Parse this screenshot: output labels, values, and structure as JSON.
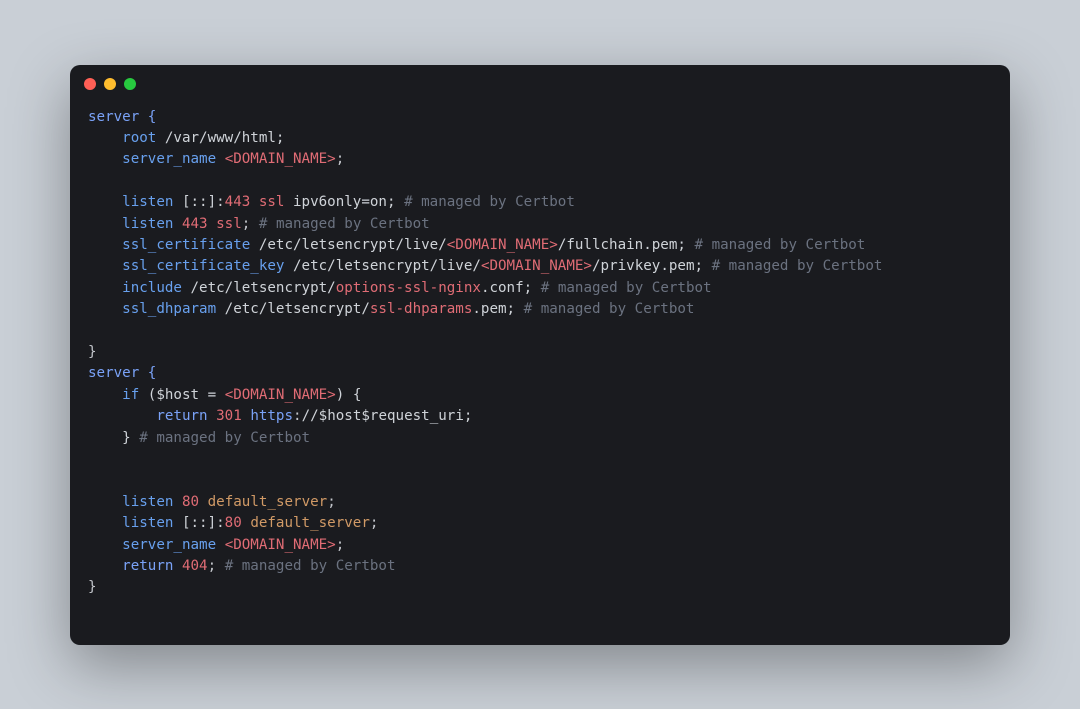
{
  "window": {
    "traffic_lights": [
      "close",
      "minimize",
      "zoom"
    ]
  },
  "code": {
    "lines": [
      [
        {
          "t": "server {",
          "c": "kw"
        }
      ],
      [
        {
          "t": "    ",
          "c": "pun"
        },
        {
          "t": "root",
          "c": "kw2"
        },
        {
          "t": " /var/www/html;",
          "c": "str"
        }
      ],
      [
        {
          "t": "    ",
          "c": "pun"
        },
        {
          "t": "server_name",
          "c": "kw2"
        },
        {
          "t": " ",
          "c": "pun"
        },
        {
          "t": "<DOMAIN_NAME>",
          "c": "var"
        },
        {
          "t": ";",
          "c": "pun"
        }
      ],
      [],
      [
        {
          "t": "    ",
          "c": "pun"
        },
        {
          "t": "listen",
          "c": "kw2"
        },
        {
          "t": " [::]:",
          "c": "str"
        },
        {
          "t": "443",
          "c": "num"
        },
        {
          "t": " ",
          "c": "pun"
        },
        {
          "t": "ssl",
          "c": "num"
        },
        {
          "t": " ipv6only=on; ",
          "c": "str"
        },
        {
          "t": "# managed by Certbot",
          "c": "cmt"
        }
      ],
      [
        {
          "t": "    ",
          "c": "pun"
        },
        {
          "t": "listen",
          "c": "kw2"
        },
        {
          "t": " ",
          "c": "pun"
        },
        {
          "t": "443",
          "c": "num"
        },
        {
          "t": " ",
          "c": "pun"
        },
        {
          "t": "ssl",
          "c": "num"
        },
        {
          "t": "; ",
          "c": "pun"
        },
        {
          "t": "# managed by Certbot",
          "c": "cmt"
        }
      ],
      [
        {
          "t": "    ",
          "c": "pun"
        },
        {
          "t": "ssl_certificate",
          "c": "kw2"
        },
        {
          "t": " /etc/letsencrypt/live/",
          "c": "str"
        },
        {
          "t": "<DOMAIN_NAME>",
          "c": "var"
        },
        {
          "t": "/fullchain.pem; ",
          "c": "str"
        },
        {
          "t": "# managed by Certbot",
          "c": "cmt"
        }
      ],
      [
        {
          "t": "    ",
          "c": "pun"
        },
        {
          "t": "ssl_certificate_key",
          "c": "kw2"
        },
        {
          "t": " /etc/letsencrypt/live/",
          "c": "str"
        },
        {
          "t": "<DOMAIN_NAME>",
          "c": "var"
        },
        {
          "t": "/privkey.pem; ",
          "c": "str"
        },
        {
          "t": "# managed by Certbot",
          "c": "cmt"
        }
      ],
      [
        {
          "t": "    ",
          "c": "pun"
        },
        {
          "t": "include",
          "c": "kw2"
        },
        {
          "t": " /etc/letsencrypt/",
          "c": "str"
        },
        {
          "t": "options-ssl-nginx",
          "c": "var"
        },
        {
          "t": ".conf; ",
          "c": "str"
        },
        {
          "t": "# managed by Certbot",
          "c": "cmt"
        }
      ],
      [
        {
          "t": "    ",
          "c": "pun"
        },
        {
          "t": "ssl_dhparam",
          "c": "kw2"
        },
        {
          "t": " /etc/letsencrypt/",
          "c": "str"
        },
        {
          "t": "ssl-dhparams",
          "c": "var"
        },
        {
          "t": ".pem; ",
          "c": "str"
        },
        {
          "t": "# managed by Certbot",
          "c": "cmt"
        }
      ],
      [],
      [
        {
          "t": "}",
          "c": "pun"
        }
      ],
      [
        {
          "t": "server {",
          "c": "kw"
        }
      ],
      [
        {
          "t": "    ",
          "c": "pun"
        },
        {
          "t": "if",
          "c": "kw2"
        },
        {
          "t": " ($host = ",
          "c": "str"
        },
        {
          "t": "<DOMAIN_NAME>",
          "c": "var"
        },
        {
          "t": ") {",
          "c": "str"
        }
      ],
      [
        {
          "t": "        ",
          "c": "pun"
        },
        {
          "t": "return",
          "c": "ret"
        },
        {
          "t": " ",
          "c": "pun"
        },
        {
          "t": "301",
          "c": "num"
        },
        {
          "t": " ",
          "c": "pun"
        },
        {
          "t": "https",
          "c": "https"
        },
        {
          "t": ":",
          "c": "pun"
        },
        {
          "t": "//$host$request_uri;",
          "c": "str"
        }
      ],
      [
        {
          "t": "    } ",
          "c": "str"
        },
        {
          "t": "# managed by Certbot",
          "c": "cmt"
        }
      ],
      [],
      [],
      [
        {
          "t": "    ",
          "c": "pun"
        },
        {
          "t": "listen",
          "c": "kw2"
        },
        {
          "t": " ",
          "c": "pun"
        },
        {
          "t": "80",
          "c": "num"
        },
        {
          "t": " ",
          "c": "pun"
        },
        {
          "t": "default_server",
          "c": "def"
        },
        {
          "t": ";",
          "c": "pun"
        }
      ],
      [
        {
          "t": "    ",
          "c": "pun"
        },
        {
          "t": "listen",
          "c": "kw2"
        },
        {
          "t": " [::]:",
          "c": "str"
        },
        {
          "t": "80",
          "c": "num"
        },
        {
          "t": " ",
          "c": "pun"
        },
        {
          "t": "default_server",
          "c": "def"
        },
        {
          "t": ";",
          "c": "pun"
        }
      ],
      [
        {
          "t": "    ",
          "c": "pun"
        },
        {
          "t": "server_name",
          "c": "kw2"
        },
        {
          "t": " ",
          "c": "pun"
        },
        {
          "t": "<DOMAIN_NAME>",
          "c": "var"
        },
        {
          "t": ";",
          "c": "pun"
        }
      ],
      [
        {
          "t": "    ",
          "c": "pun"
        },
        {
          "t": "return",
          "c": "ret"
        },
        {
          "t": " ",
          "c": "pun"
        },
        {
          "t": "404",
          "c": "num"
        },
        {
          "t": "; ",
          "c": "pun"
        },
        {
          "t": "# managed by Certbot",
          "c": "cmt"
        }
      ],
      [
        {
          "t": "}",
          "c": "pun"
        }
      ]
    ]
  }
}
